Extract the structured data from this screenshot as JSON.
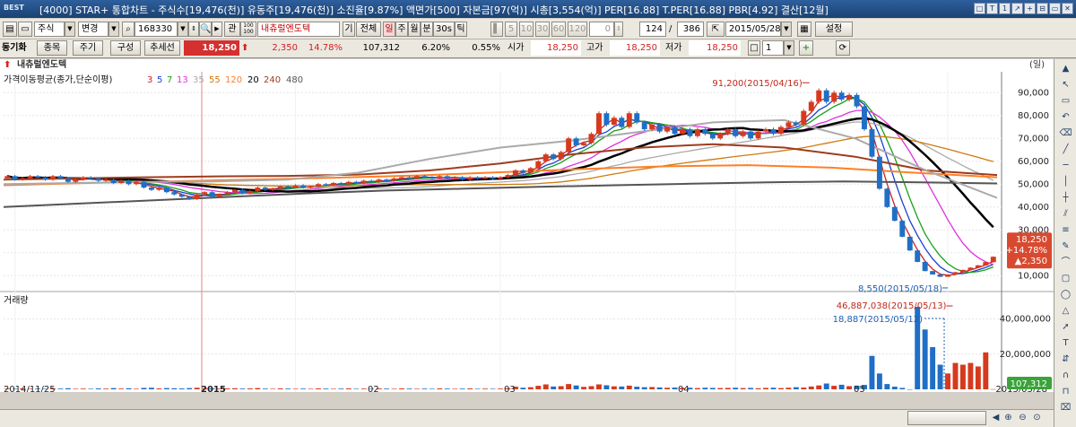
{
  "window": {
    "logo": "BEST",
    "title": "[4000] STAR+ 통합차트 - 주식수[19,476(천)] 유동주[19,476(천)] 소진율[9.87%] 액면가[500] 자본금[97(억)] 시총[3,554(억)] PER[16.88] T.PER[16.88] PBR[4.92] 결산[12월]",
    "controls": [
      "□",
      "T",
      "1",
      "↗",
      "+",
      "⊟",
      "▭",
      "✕"
    ]
  },
  "toolbar": {
    "market": "주식",
    "change": "변경",
    "code": "168330",
    "gwan": "관",
    "stock_name": "내츄럴엔도텍",
    "gi": "기",
    "all": "전체",
    "periods": [
      "일",
      "주",
      "월",
      "분",
      "30s",
      "틱"
    ],
    "nums": [
      "5",
      "10",
      "30",
      "60",
      "120"
    ],
    "zero": "0",
    "count1": "124",
    "count2": "386",
    "date": "2015/05/28",
    "settings": "설정"
  },
  "quote": {
    "tab_sync": "동기화",
    "btn_item": "종목",
    "btn_period": "주기",
    "btn_compose": "구성",
    "btn_trend": "추세선",
    "price": "18,250",
    "change": "2,350",
    "change_pct": "14.78%",
    "volume": "107,312",
    "turnover": "6.20%",
    "ratio": "0.55%",
    "open_label": "시가",
    "open": "18,250",
    "high_label": "고가",
    "high": "18,250",
    "low_label": "저가",
    "low": "18,250",
    "one": "1"
  },
  "chart": {
    "stock_title": "내츄럴엔도텍",
    "unit": "(일)",
    "ma_title": "가격이동평균(종가,단순이평)",
    "ma_periods": [
      "3",
      "5",
      "7",
      "13",
      "35",
      "55",
      "120",
      "20",
      "240",
      "480"
    ],
    "ma_colors": [
      "#d02020",
      "#1a3fd0",
      "#19a019",
      "#e030e0",
      "#aaaaaa",
      "#d07a10",
      "#ff7f27",
      "#000000",
      "#9e3c1e",
      "#555555"
    ],
    "volume_title": "거래량",
    "price_axis": [
      "90,000",
      "80,000",
      "70,000",
      "60,000",
      "50,000",
      "40,000",
      "30,000",
      "20,000",
      "10,000"
    ],
    "volume_axis": [
      "40,000,000",
      "20,000,000"
    ],
    "date_labels": [
      "2014/11/25",
      "2015",
      "02",
      "03",
      "04",
      "05",
      "2015/05/28"
    ],
    "annotations": {
      "high": "91,200(2015/04/16)",
      "low": "8,550(2015/05/18)",
      "vol_max": "46,887,038(2015/05/13)",
      "vol_ref": "18,887(2015/05/12)"
    },
    "last_price_tag": [
      "18,250",
      "+14.78%",
      "▲2,350"
    ],
    "last_volume_tag": "107,312"
  },
  "chart_data": {
    "type": "candlestick",
    "title": "",
    "ylim": [
      5000,
      96000
    ],
    "y_ticks": [
      10000,
      20000,
      30000,
      40000,
      50000,
      60000,
      70000,
      80000,
      90000
    ],
    "candles": [
      {
        "o": 52500,
        "c": 53500
      },
      {
        "o": 53500,
        "c": 52000
      },
      {
        "o": 52000,
        "c": 52500
      },
      {
        "o": 52500,
        "c": 53500
      },
      {
        "o": 53500,
        "c": 53000
      },
      {
        "o": 53000,
        "c": 52000
      },
      {
        "o": 52000,
        "c": 53500
      },
      {
        "o": 53500,
        "c": 52500
      },
      {
        "o": 52500,
        "c": 51000
      },
      {
        "o": 51000,
        "c": 52000
      },
      {
        "o": 52000,
        "c": 53000
      },
      {
        "o": 53000,
        "c": 52500
      },
      {
        "o": 52500,
        "c": 51500
      },
      {
        "o": 51500,
        "c": 52000
      },
      {
        "o": 52000,
        "c": 50500
      },
      {
        "o": 50500,
        "c": 51500
      },
      {
        "o": 51500,
        "c": 50000
      },
      {
        "o": 50000,
        "c": 51000
      },
      {
        "o": 51000,
        "c": 48500
      },
      {
        "o": 48500,
        "c": 47500
      },
      {
        "o": 47500,
        "c": 48500
      },
      {
        "o": 48500,
        "c": 46500
      },
      {
        "o": 46500,
        "c": 45500
      },
      {
        "o": 45500,
        "c": 44500
      },
      {
        "o": 44500,
        "c": 43500
      },
      {
        "o": 43500,
        "c": 45500
      },
      {
        "o": 45500,
        "c": 46500
      },
      {
        "o": 46500,
        "c": 44500
      },
      {
        "o": 44500,
        "c": 45500
      },
      {
        "o": 45500,
        "c": 46500
      },
      {
        "o": 46500,
        "c": 47500
      },
      {
        "o": 47500,
        "c": 46000
      },
      {
        "o": 46000,
        "c": 47000
      },
      {
        "o": 47000,
        "c": 48500
      },
      {
        "o": 48500,
        "c": 47500
      },
      {
        "o": 47500,
        "c": 48000
      },
      {
        "o": 48000,
        "c": 49000
      },
      {
        "o": 49000,
        "c": 48500
      },
      {
        "o": 48500,
        "c": 49500
      },
      {
        "o": 49500,
        "c": 48500
      },
      {
        "o": 48500,
        "c": 49000
      },
      {
        "o": 49000,
        "c": 50000
      },
      {
        "o": 50000,
        "c": 49500
      },
      {
        "o": 49500,
        "c": 50500
      },
      {
        "o": 50500,
        "c": 50000
      },
      {
        "o": 50000,
        "c": 51000
      },
      {
        "o": 51000,
        "c": 50500
      },
      {
        "o": 50500,
        "c": 51500
      },
      {
        "o": 51500,
        "c": 51000
      },
      {
        "o": 51000,
        "c": 52000
      },
      {
        "o": 52000,
        "c": 51500
      },
      {
        "o": 51500,
        "c": 52500
      },
      {
        "o": 52500,
        "c": 53000
      },
      {
        "o": 53000,
        "c": 52500
      },
      {
        "o": 52500,
        "c": 53500
      },
      {
        "o": 53500,
        "c": 53000
      },
      {
        "o": 53000,
        "c": 52500
      },
      {
        "o": 52500,
        "c": 53500
      },
      {
        "o": 53500,
        "c": 52500
      },
      {
        "o": 52500,
        "c": 53000
      },
      {
        "o": 53000,
        "c": 52000
      },
      {
        "o": 52000,
        "c": 53000
      },
      {
        "o": 53000,
        "c": 52500
      },
      {
        "o": 52500,
        "c": 53000
      },
      {
        "o": 53000,
        "c": 52500
      },
      {
        "o": 52500,
        "c": 53000
      },
      {
        "o": 53000,
        "c": 54000
      },
      {
        "o": 54000,
        "c": 56000
      },
      {
        "o": 56000,
        "c": 55000
      },
      {
        "o": 55000,
        "c": 57000
      },
      {
        "o": 57000,
        "c": 60000
      },
      {
        "o": 60000,
        "c": 63000
      },
      {
        "o": 63000,
        "c": 61000
      },
      {
        "o": 61000,
        "c": 64000
      },
      {
        "o": 64000,
        "c": 70000
      },
      {
        "o": 70000,
        "c": 67000
      },
      {
        "o": 67000,
        "c": 68000
      },
      {
        "o": 68000,
        "c": 72000
      },
      {
        "o": 72000,
        "c": 81000
      },
      {
        "o": 81000,
        "c": 76000
      },
      {
        "o": 76000,
        "c": 79000
      },
      {
        "o": 79000,
        "c": 75000
      },
      {
        "o": 75000,
        "c": 81000
      },
      {
        "o": 81000,
        "c": 77000
      },
      {
        "o": 77000,
        "c": 74000
      },
      {
        "o": 74000,
        "c": 76000
      },
      {
        "o": 76000,
        "c": 73000
      },
      {
        "o": 73000,
        "c": 75000
      },
      {
        "o": 75000,
        "c": 72000
      },
      {
        "o": 72000,
        "c": 74000
      },
      {
        "o": 74000,
        "c": 71000
      },
      {
        "o": 71000,
        "c": 74000
      },
      {
        "o": 74000,
        "c": 72000
      },
      {
        "o": 72000,
        "c": 70000
      },
      {
        "o": 70000,
        "c": 72000
      },
      {
        "o": 72000,
        "c": 74000
      },
      {
        "o": 74000,
        "c": 71000
      },
      {
        "o": 71000,
        "c": 73000
      },
      {
        "o": 73000,
        "c": 70000
      },
      {
        "o": 70000,
        "c": 73000
      },
      {
        "o": 73000,
        "c": 74000
      },
      {
        "o": 74000,
        "c": 72000
      },
      {
        "o": 72000,
        "c": 75000
      },
      {
        "o": 75000,
        "c": 77000
      },
      {
        "o": 77000,
        "c": 76000
      },
      {
        "o": 76000,
        "c": 82000
      },
      {
        "o": 82000,
        "c": 86000
      },
      {
        "o": 86000,
        "c": 91000
      },
      {
        "o": 91000,
        "c": 86000
      },
      {
        "o": 86000,
        "c": 90000
      },
      {
        "o": 90000,
        "c": 87000
      },
      {
        "o": 87000,
        "c": 89000
      },
      {
        "o": 89000,
        "c": 84000
      },
      {
        "o": 84000,
        "c": 74000
      },
      {
        "o": 74000,
        "c": 62000
      },
      {
        "o": 62000,
        "c": 48000
      },
      {
        "o": 48000,
        "c": 40000
      },
      {
        "o": 40000,
        "c": 34000
      },
      {
        "o": 34000,
        "c": 27000
      },
      {
        "o": 27000,
        "c": 21000
      },
      {
        "o": 21000,
        "c": 16000
      },
      {
        "o": 16000,
        "c": 12000
      },
      {
        "o": 12000,
        "c": 10500
      },
      {
        "o": 10500,
        "c": 9500
      },
      {
        "o": 9500,
        "c": 10500
      },
      {
        "o": 10500,
        "c": 11500
      },
      {
        "o": 11500,
        "c": 12500
      },
      {
        "o": 12500,
        "c": 13500
      },
      {
        "o": 13500,
        "c": 14500
      },
      {
        "o": 14500,
        "c": 15900
      },
      {
        "o": 15900,
        "c": 18250
      }
    ],
    "volume_ylim": [
      0,
      52000000
    ],
    "volumes": [
      400000,
      300000,
      500000,
      300000,
      400000,
      300000,
      500000,
      400000,
      600000,
      300000,
      400000,
      300000,
      500000,
      400000,
      700000,
      400000,
      600000,
      300000,
      800000,
      900000,
      500000,
      700000,
      600000,
      500000,
      700000,
      900000,
      600000,
      500000,
      400000,
      500000,
      600000,
      400000,
      500000,
      700000,
      400000,
      300000,
      500000,
      400000,
      300000,
      400000,
      300000,
      500000,
      400000,
      300000,
      400000,
      500000,
      300000,
      400000,
      300000,
      500000,
      400000,
      300000,
      500000,
      400000,
      300000,
      400000,
      300000,
      500000,
      400000,
      300000,
      400000,
      500000,
      300000,
      400000,
      300000,
      400000,
      600000,
      1500000,
      900000,
      1200000,
      2000000,
      2800000,
      1600000,
      1800000,
      3000000,
      2200000,
      1400000,
      1800000,
      2800000,
      2300000,
      1700000,
      1600000,
      2100000,
      1500000,
      1200000,
      1300000,
      1100000,
      900000,
      1000000,
      800000,
      900000,
      700000,
      900000,
      800000,
      700000,
      800000,
      900000,
      700000,
      800000,
      600000,
      800000,
      900000,
      700000,
      900000,
      1200000,
      1000000,
      1600000,
      2200000,
      3300000,
      2000000,
      2600000,
      1800000,
      2100000,
      2500000,
      19000000,
      9000000,
      3000000,
      1500000,
      800000,
      18887,
      46887038,
      34000000,
      24000000,
      14000000,
      9000000,
      15000000,
      14000000,
      15000000,
      13000000,
      21000000,
      107312
    ]
  }
}
